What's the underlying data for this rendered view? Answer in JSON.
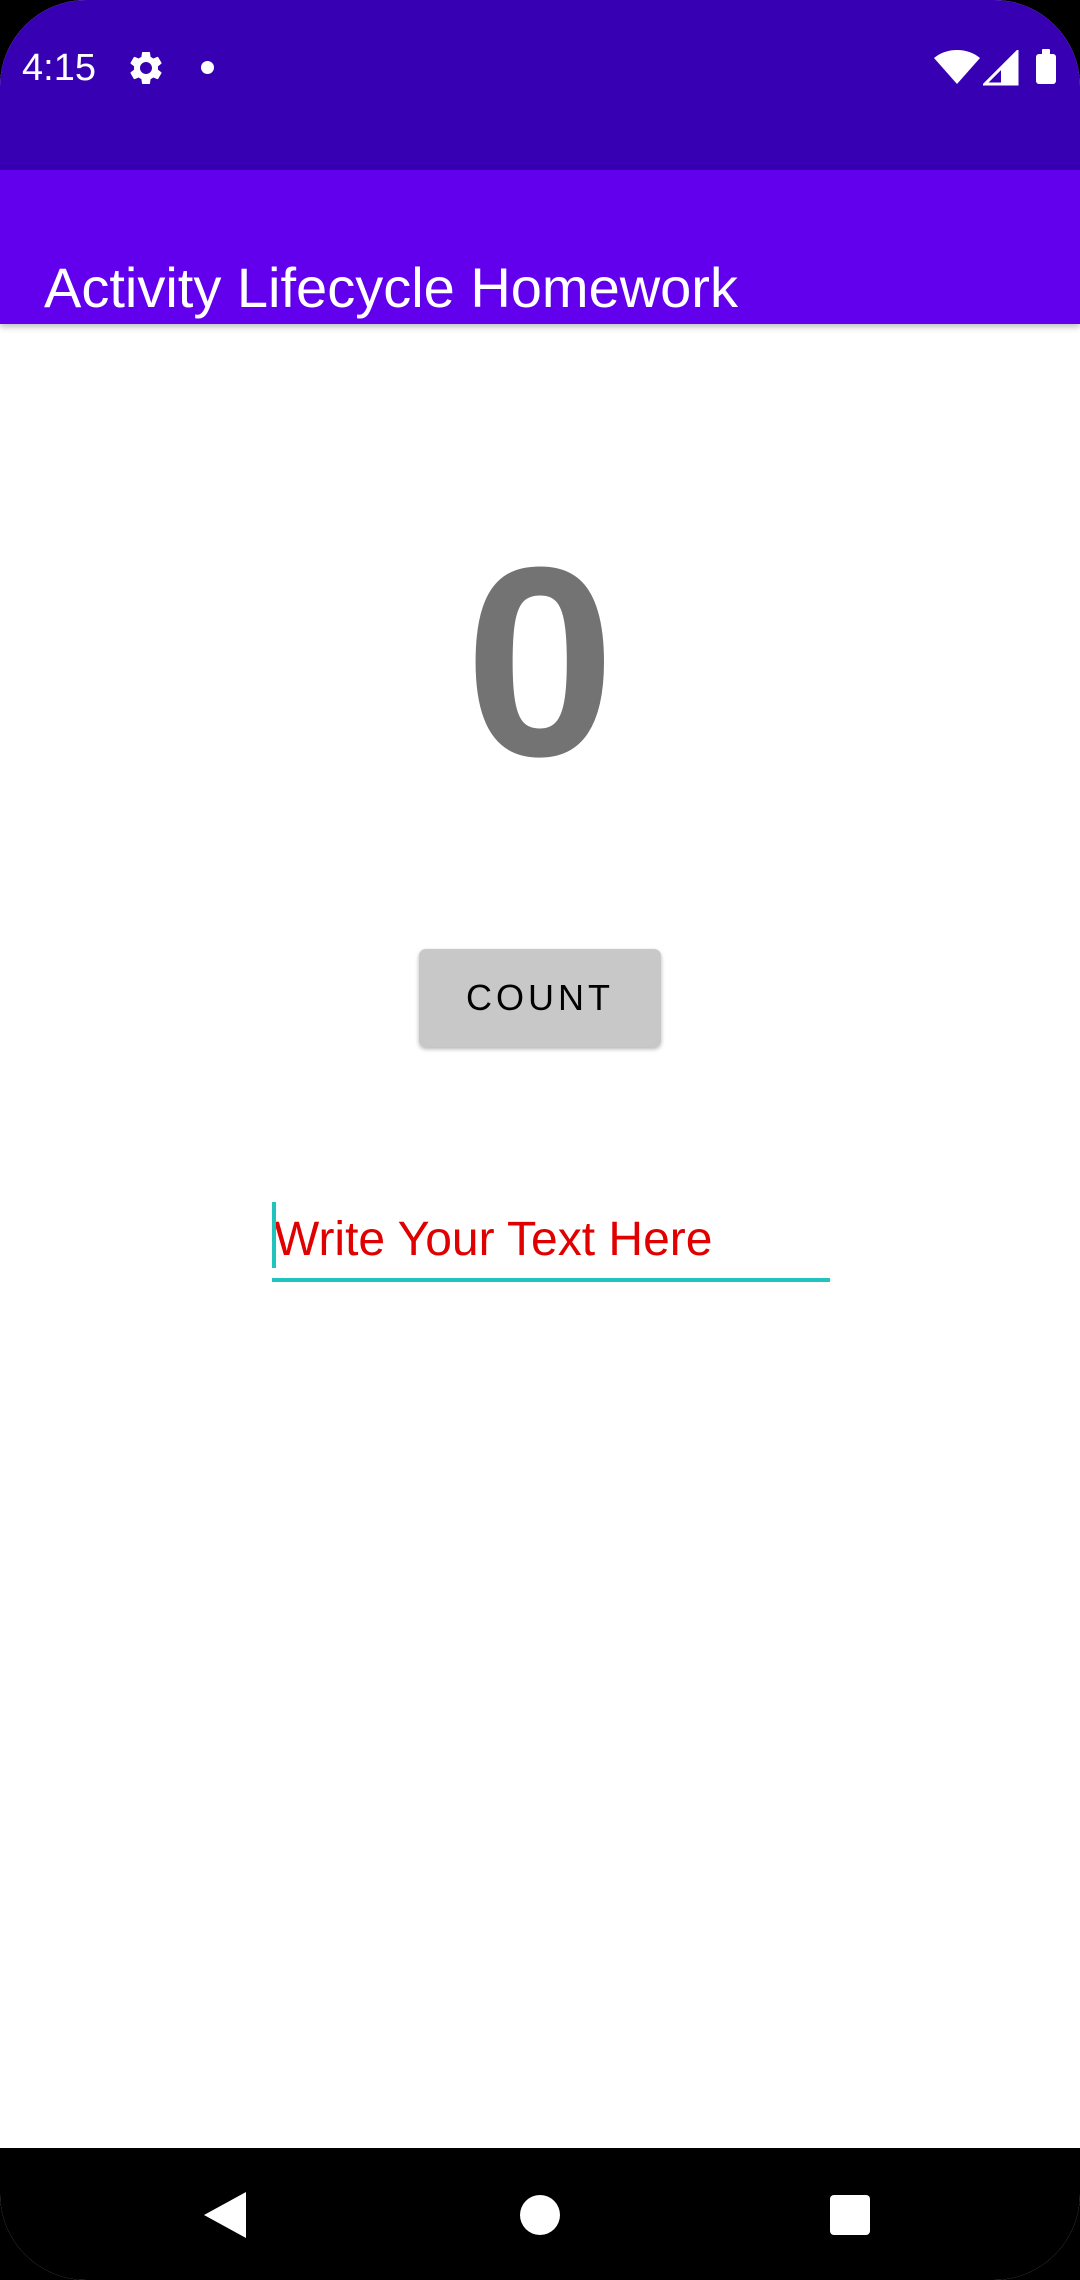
{
  "status_bar": {
    "time": "4:15",
    "icons": [
      "gear-icon",
      "notification-dot-icon",
      "wifi-icon",
      "signal-icon",
      "battery-icon"
    ]
  },
  "app_bar": {
    "title": "Activity Lifecycle Homework",
    "color": "#6200ee"
  },
  "main": {
    "counter_value": "0",
    "count_button_label": "COUNT",
    "text_input": {
      "value": "",
      "placeholder": "Write Your Text Here",
      "text_color": "#e00000",
      "underline_color": "#20c4bc"
    }
  },
  "colors": {
    "status_bar": "#3700b3",
    "app_bar": "#6200ee",
    "counter_text": "#737373",
    "button_bg": "#c8c8c8"
  },
  "nav_bar": {
    "icons": [
      "back-icon",
      "home-icon",
      "recents-icon"
    ]
  }
}
